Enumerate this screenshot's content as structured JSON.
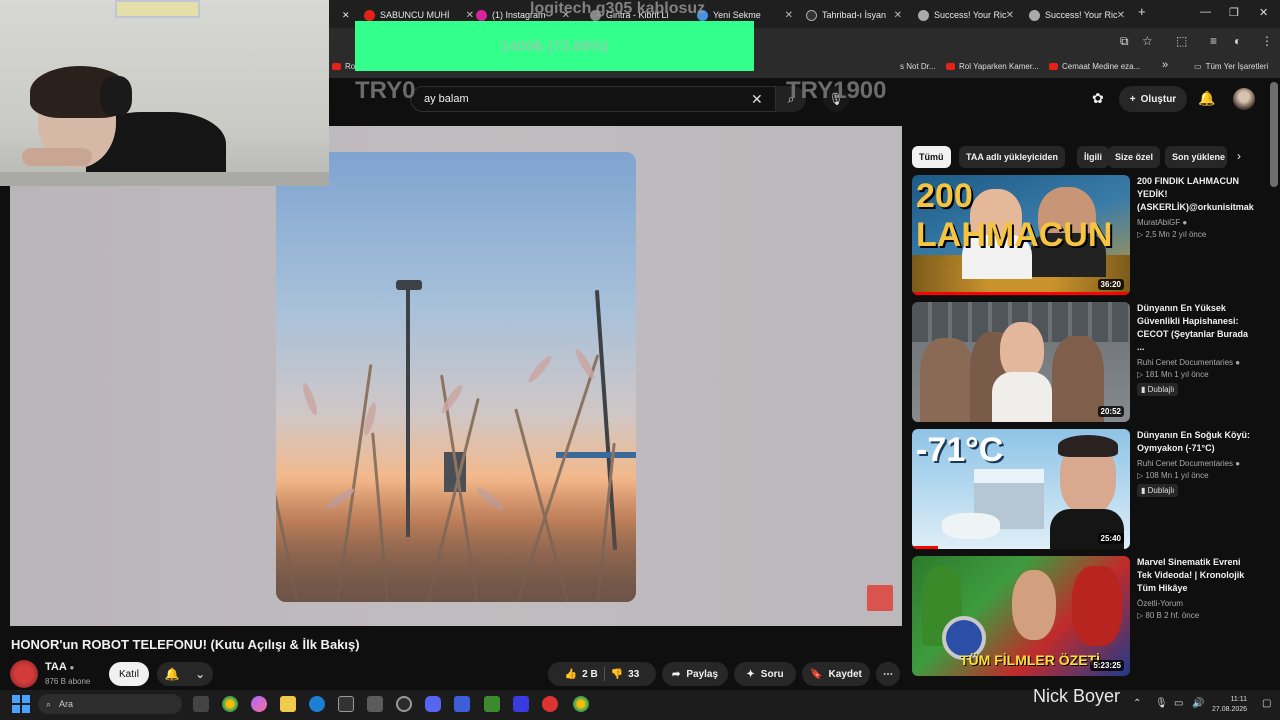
{
  "browser": {
    "tabs": [
      {
        "label": "SABUNCU MUHİ",
        "fav": "#e62117"
      },
      {
        "label": "(1) Instagram",
        "fav": "#d6249f"
      },
      {
        "label": "Gintra - Kibrit Li",
        "fav": "#888888"
      },
      {
        "label": "Yeni Sekme",
        "fav": "#4a90e2"
      },
      {
        "label": "Tahribad-ı İsyan",
        "fav": "#333333"
      },
      {
        "label": "Success! Your Ric",
        "fav": "#aaaaaa"
      },
      {
        "label": "Success! Your Ric",
        "fav": "#aaaaaa"
      }
    ],
    "new_tab": "+",
    "bookmarks": [
      {
        "label": "Ro"
      },
      {
        "label": "s Not Dr..."
      },
      {
        "label": "Rol Yaparken Kamer..."
      },
      {
        "label": "Cemaat Medine eza..."
      }
    ],
    "bookmarks_more": "»",
    "all_bookmarks": "Tüm Yer İşaretleri"
  },
  "overlay": {
    "donation_title": "logitech g305 kablosuz",
    "donation_amount": "1400₺ (73.68%)",
    "try_left": "TRY0",
    "try_right": "TRY1900",
    "streamer_name": "Nick Boyer"
  },
  "header": {
    "search_value": "ay balam",
    "create_label": "Oluştur"
  },
  "video": {
    "title": "HONOR'un ROBOT TELEFONU! (Kutu Açılışı & İlk Bakış)",
    "channel": "TAA",
    "subscribers": "876 B abone",
    "join_label": "Katıl",
    "likes": "2 B",
    "dislikes": "33",
    "share_label": "Paylaş",
    "ask_label": "Soru",
    "save_label": "Kaydet"
  },
  "chips": [
    "Tümü",
    "TAA adlı yükleyiciden",
    "İlgili",
    "Size özel",
    "Son yüklene"
  ],
  "recommendations": [
    {
      "title": "200 FINDIK LAHMACUN YEDİK! (ASKERLİK)@orkunisitmak",
      "channel": "MuratAbiGF",
      "meta": "2,5 Mn   2 yıl önce",
      "duration": "36:20",
      "tag": "",
      "thumb_text": "200 LAHMACUN"
    },
    {
      "title": "Dünyanın En Yüksek Güvenlikli Hapishanesi: CECOT (Şeytanlar Burada ...",
      "channel": "Ruhi Cenet Documentaries",
      "meta": "181 Mn   1 yıl önce",
      "duration": "20:52",
      "tag": "Dublajlı",
      "thumb_text": ""
    },
    {
      "title": "Dünyanın En Soğuk Köyü: Oymyakon (-71°C)",
      "channel": "Ruhi Cenet Documentaries",
      "meta": "108 Mn   1 yıl önce",
      "duration": "25:40",
      "tag": "Dublajlı",
      "thumb_text": "-71°C"
    },
    {
      "title": "Marvel Sinematik Evreni Tek Videoda! | Kronolojik Tüm Hikâye",
      "channel": "Özetli-Yorum",
      "meta": "80 B   2 hf. önce",
      "duration": "5:23:25",
      "tag": "",
      "thumb_text": "TÜM FİLMLER ÖZETİ"
    }
  ],
  "taskbar": {
    "search_placeholder": "Ara",
    "time": "11:11",
    "date": "27.08.2026"
  },
  "colors": {
    "accent": "#ff0000",
    "donation_bar": "#33ff8c",
    "youtube_bg": "#0f0f0f"
  }
}
